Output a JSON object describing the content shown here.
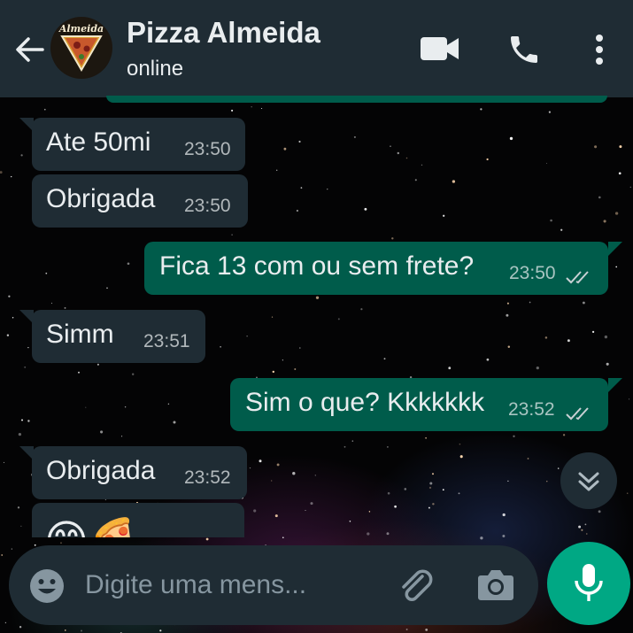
{
  "header": {
    "contact_name": "Pizza Almeida",
    "status": "online",
    "avatar_text": "Almeida"
  },
  "messages": [
    {
      "direction": "in",
      "text": "Ate 50mi",
      "time": "23:50"
    },
    {
      "direction": "in",
      "text": "Obrigada",
      "time": "23:50"
    },
    {
      "direction": "out",
      "text": "Fica 13 com ou sem frete?",
      "time": "23:50",
      "status": "read"
    },
    {
      "direction": "in",
      "text": "Simm",
      "time": "23:51"
    },
    {
      "direction": "out",
      "text": "Sim o que? Kkkkkkk",
      "time": "23:52",
      "status": "read"
    },
    {
      "direction": "in",
      "text": "Obrigada",
      "time": "23:52"
    },
    {
      "direction": "in",
      "text": "😊🍕",
      "time": ""
    }
  ],
  "composer": {
    "placeholder": "Digite uma mens..."
  },
  "icons": {
    "back": "arrow-left-icon",
    "video": "video-camera-icon",
    "call": "phone-icon",
    "menu": "more-vertical-icon",
    "scroll": "double-chevron-down-icon",
    "emoji": "emoji-icon",
    "attach": "paperclip-icon",
    "camera": "camera-icon",
    "mic": "microphone-icon"
  },
  "colors": {
    "header": "#1f2c34",
    "incoming_bubble": "#1f2c34",
    "outgoing_bubble": "#005c4b",
    "accent": "#00a884"
  }
}
